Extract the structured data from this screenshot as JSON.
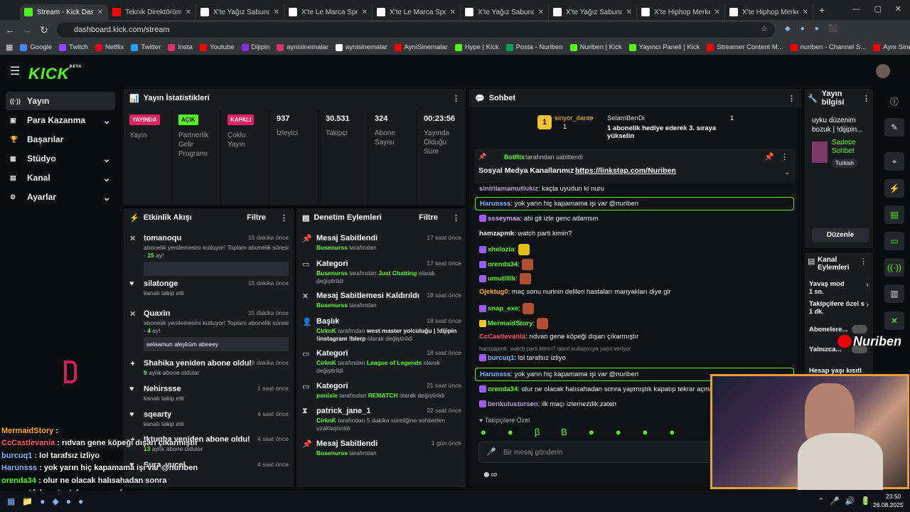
{
  "browser": {
    "tabs": [
      {
        "label": "Stream - Kick Dashboard",
        "active": true,
        "fav": "#53fc18"
      },
      {
        "label": "Teknik Direktörümüz",
        "fav": "#ff0000"
      },
      {
        "label": "X'te Yağız Sabuncuoğ",
        "fav": "#ffffff"
      },
      {
        "label": "X'te Le Marca Sports",
        "fav": "#ffffff"
      },
      {
        "label": "X'te Le Marca Sports",
        "fav": "#ffffff"
      },
      {
        "label": "X'te Yağız Sabuncuoğ",
        "fav": "#ffffff"
      },
      {
        "label": "X'te Yağız Sabuncuoğ",
        "fav": "#ffffff"
      },
      {
        "label": "X'te Hiphop Merkezi",
        "fav": "#ffffff"
      },
      {
        "label": "X'te Hiphop Merkezi",
        "fav": "#ffffff"
      }
    ],
    "url": "dashboard.kick.com/stream",
    "bookmarks": [
      "Google",
      "Twitch",
      "Netflix",
      "Twitter",
      "Insta",
      "Youtube",
      "Dijipin",
      "aynisinemalar",
      "aynisinemalar",
      "AyniSinemalar",
      "Hype | Kick",
      "Posta - Nuriben",
      "Nuriben | Kick",
      "Yayıncı Paneli | Kick",
      "Streamer Content M...",
      "nuriben - Channel S...",
      "Aynı Sinemalar - Ça..."
    ]
  },
  "app": {
    "logo": "KICK",
    "beta": "BETA"
  },
  "sidebar": {
    "items": [
      {
        "label": "Yayın",
        "icon": "broadcast-icon",
        "chev": false,
        "active": true
      },
      {
        "label": "Para Kazanma",
        "icon": "money-icon",
        "chev": true
      },
      {
        "label": "Başarılar",
        "icon": "trophy-icon",
        "chev": false
      },
      {
        "label": "Stüdyo",
        "icon": "studio-icon",
        "chev": true
      },
      {
        "label": "Kanal",
        "icon": "channel-icon",
        "chev": true
      },
      {
        "label": "Ayarlar",
        "icon": "gear-icon",
        "chev": true
      }
    ]
  },
  "stats": {
    "title": "Yayın İstatistikleri",
    "cols": [
      {
        "badge": "YAYINDA",
        "badge_color": "#e91e63",
        "label": "Yayın"
      },
      {
        "badge": "AÇIK",
        "badge_color": "#53fc18",
        "label": "Partnerlik Gelir Programı"
      },
      {
        "badge": "KAPALI",
        "badge_color": "#e91e63",
        "label": "Çoklu Yayın"
      },
      {
        "value": "937",
        "label": "İzleyici"
      },
      {
        "value": "30.531",
        "label": "Takipçi"
      },
      {
        "value": "324",
        "label": "Abone Sayısı"
      },
      {
        "value": "00:23:56",
        "label": "Yayında Olduğu Süre"
      }
    ]
  },
  "events": {
    "title": "Etkinlik Akışı",
    "filter": "Filtre",
    "items": [
      {
        "name": "tomanoqu",
        "time": "15 dakika önce",
        "desc": "abonelik yenilemesini kutluyor! Toplam abonelik süresi - ",
        "hl": "15",
        "desc2": " ay!",
        "box": "",
        "icon": "✕"
      },
      {
        "name": "silatonge",
        "time": "15 dakika önce",
        "desc": "kanalı takip etti",
        "icon": "♥"
      },
      {
        "name": "Quaxin",
        "time": "15 dakika önce",
        "desc": "abonelik yenilemesini kutluyor! Toplam abonelik süresi - ",
        "hl": "4",
        "desc2": " ay!",
        "box": "selaamun aleyküm abeeey",
        "icon": "✕"
      },
      {
        "name": "Shahika yeniden abone oldu!",
        "time": "19 dakika önce",
        "hl": "9",
        "desc2": " aylık abone oldular",
        "icon": "✦"
      },
      {
        "name": "Nehirssse",
        "time": "1 saat önce",
        "desc": "kanalı takip etti",
        "icon": "♥"
      },
      {
        "name": "sqearty",
        "time": "4 saat önce",
        "desc": "kanalı takip etti",
        "icon": "♥"
      },
      {
        "name": "tktugba yeniden abone oldu!",
        "time": "4 saat önce",
        "hl": "13",
        "desc2": " aylık abone oldular",
        "icon": "✦"
      },
      {
        "name": "Sura_yucel",
        "time": "4 saat önce",
        "desc": "",
        "icon": "♥"
      }
    ]
  },
  "audit": {
    "title": "Denetim Eylemleri",
    "filter": "Filtre",
    "items": [
      {
        "title": "Mesaj Sabitlendi",
        "time": "17 saat önce",
        "user": "Busenurss",
        "rest": " tarafından",
        "icon": "📌"
      },
      {
        "title": "Kategori",
        "time": "17 saat önce",
        "user": "Busenurss",
        "rest": " tarafından ",
        "hl": "Just Chatting",
        "rest2": " olarak değiştirildi",
        "icon": "▭"
      },
      {
        "title": "Mesaj Sabitlemesi Kaldırıldı",
        "time": "18 saat önce",
        "user": "Busenurss",
        "rest": " tarafından",
        "icon": "✕"
      },
      {
        "title": "Başlık",
        "time": "18 saat önce",
        "user": "CirknK",
        "rest": " tarafından ",
        "bold": "west master yolculuğu | !dijipin !instagram !blerp",
        "rest2": " olarak değiştirildi",
        "icon": "👤"
      },
      {
        "title": "Kategori",
        "time": "18 saat önce",
        "user": "CirknK",
        "rest": " tarafından ",
        "hl": "League of Legends",
        "rest2": " olarak değiştirildi",
        "icon": "▭"
      },
      {
        "title": "Kategori",
        "time": "21 saat önce",
        "user": "ponixie",
        "rest": " tarafından ",
        "hl": "REMATCH",
        "rest2": " olarak değiştirildi",
        "icon": "▭"
      },
      {
        "title": "patrick_jane_1",
        "time": "22 saat önce",
        "user": "CirknK",
        "rest": " tarafından 5 dakika süreliğine sohbetten uzaklaştırıldı",
        "icon": "⧗"
      },
      {
        "title": "Mesaj Sabitlendi",
        "time": "1 gün önce",
        "user": "Busenurss",
        "rest": " tarafından",
        "icon": "📌"
      }
    ]
  },
  "chat": {
    "title": "Sohbet",
    "top_gifter": {
      "name": "sinyor_dante",
      "count": "1"
    },
    "gift_user": "SelamBenDi",
    "gift_text": "1 abonelik hediye ederek 3. sıraya yükselin",
    "gift_count": "1",
    "pinned": {
      "by": "BotRix",
      "by_rest": " tarafından sabitlendi",
      "text": "Sosyal Medya Kanallarımız→ ",
      "link": "https://linkstap.com/Nuriben"
    },
    "messages": [
      {
        "user": "siniriiamamutlukiz",
        "color": "#b39ddb",
        "text": ": kaçta uyudun ki nuru"
      },
      {
        "user": "Harunsss",
        "color": "#7eb6ff",
        "text": ": yok yarın hiç kapamama işi var @nuriben",
        "highlight": true
      },
      {
        "user": "ssseymaa",
        "color": "#c9a0ff",
        "text": ": abi git izle genc adamsın"
      },
      {
        "user": "hamzapmk",
        "color": "#ffffff",
        "text": ": watch parti kimin?"
      },
      {
        "user": "xhelozia",
        "color": "#53fc18",
        "text": ":"
      },
      {
        "user": "orenda34",
        "color": "#53fc18",
        "text": ":"
      },
      {
        "user": "umutlilik",
        "color": "#53fc18",
        "text": ":"
      },
      {
        "user": "Ojektug0",
        "color": "#ffb000",
        "text": ": maç sonu nurinin delileri hastaları manyakları diye gir"
      },
      {
        "user": "snap_exe",
        "color": "#53fc18",
        "text": ":"
      },
      {
        "user": "MermaidStory",
        "color": "#53fc18",
        "text": ":"
      },
      {
        "user": "CcCastlevania",
        "color": "#ff4d6d",
        "text": ": rıdvan gene köpeği dışarı çıkarmıştır"
      },
      {
        "user": "burcuq1",
        "color": "#7eb6ff",
        "text": ": lol tarafsız izliyo",
        "reply": "hamzapmk: watch parti kimin? isimli kullanıcıya yanıt veriyor"
      },
      {
        "user": "Harunsss",
        "color": "#7eb6ff",
        "text": ": yok yarın hiç kapamama işi var @nuriben",
        "highlight": true
      },
      {
        "user": "orenda34",
        "color": "#53fc18",
        "text": ": olur ne olacak halısahadan sonra yapmıştık kapatıp tekrar açma o"
      },
      {
        "user": "benkulustursen",
        "color": "#b39ddb",
        "text": ": ilk maçı izlemezdik zaten"
      }
    ],
    "followers_only": "Takipçilere Özel",
    "input_placeholder": "Bir mesaj gönderin"
  },
  "stream_info": {
    "title": "Yayın bilgisi",
    "stream_title": "uyku düzenim bozuk | !dijipin...",
    "category": "Sadece Sohbet",
    "tag": "Turkish",
    "edit": "Düzenle"
  },
  "channel_actions": {
    "title": "Kanal Eylemleri",
    "items": [
      {
        "label": "Yavaş mod",
        "value": "1 sn."
      },
      {
        "label": "Takipçilere özel s",
        "value": "1 dk."
      },
      {
        "label": "Abonelere...",
        "value": ""
      },
      {
        "label": "Yalnızca...",
        "value": ""
      },
      {
        "label": "Hesap yaşı kısıtl",
        "value": ""
      }
    ]
  },
  "overlay": {
    "watermark": "Nuriben",
    "lines": [
      {
        "user": "MermaidStory",
        "color": "#ffb000",
        "text": " :"
      },
      {
        "user": "CcCastlevania",
        "color": "#ff4d6d",
        "text": " : rıdvan gene köpeği dışarı çıkarmıştır"
      },
      {
        "user": "burcuq1",
        "color": "#7eb6ff",
        "text": " : lol tarafsız izliyo"
      },
      {
        "user": "Harunsss",
        "color": "#7eb6ff",
        "text": " : yok yarın hiç kapamama işi var @nuriben"
      },
      {
        "user": "orenda34",
        "color": "#53fc18",
        "text": " : olur ne olacak halısahadan sonra"
      },
      {
        "user": "",
        "color": "#fff",
        "text": "yapmıştık kapatıp tekrar açma olayını"
      },
      {
        "user": "benkulustursen",
        "color": "#c9a0ff",
        "text": " : ilk maçı izlemezdik zaten"
      }
    ]
  },
  "taskbar": {
    "time": "23:50",
    "date": "26.08.2025"
  }
}
